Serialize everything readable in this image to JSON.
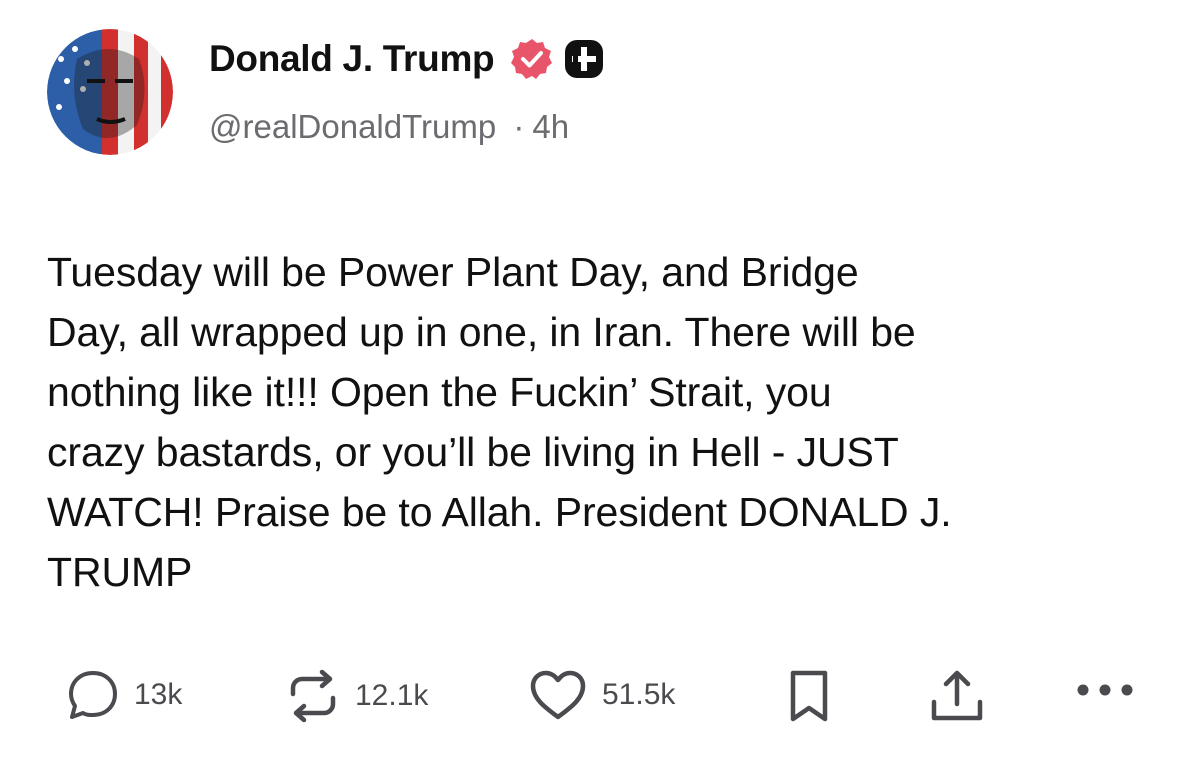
{
  "author": {
    "display_name": "Donald J. Trump",
    "handle": "@realDonaldTrump",
    "separator": "·",
    "timestamp": "4h"
  },
  "post": {
    "text": "Tuesday will be Power Plant Day, and Bridge\nDay, all wrapped up in one, in Iran. There will be\nnothing like it!!! Open the Fuckin’ Strait, you\ncrazy bastards, or you’ll be living in Hell - JUST\nWATCH! Praise be to Allah. President DONALD J.\nTRUMP"
  },
  "actions": {
    "replies": "13k",
    "reposts": "12.1k",
    "likes": "51.5k"
  },
  "icons": {
    "avatar": "avatar-image",
    "verified": "verified-badge-icon",
    "tier": "plus-badge-icon",
    "reply": "speech-bubble-icon",
    "repost": "repost-arrows-icon",
    "like": "heart-icon",
    "bookmark": "bookmark-icon",
    "share": "share-upload-icon",
    "more": "more-dots-icon"
  },
  "colors": {
    "verified": "#e8546a",
    "text": "#111111",
    "muted": "#6b6b70",
    "icon": "#4a4a4f"
  }
}
